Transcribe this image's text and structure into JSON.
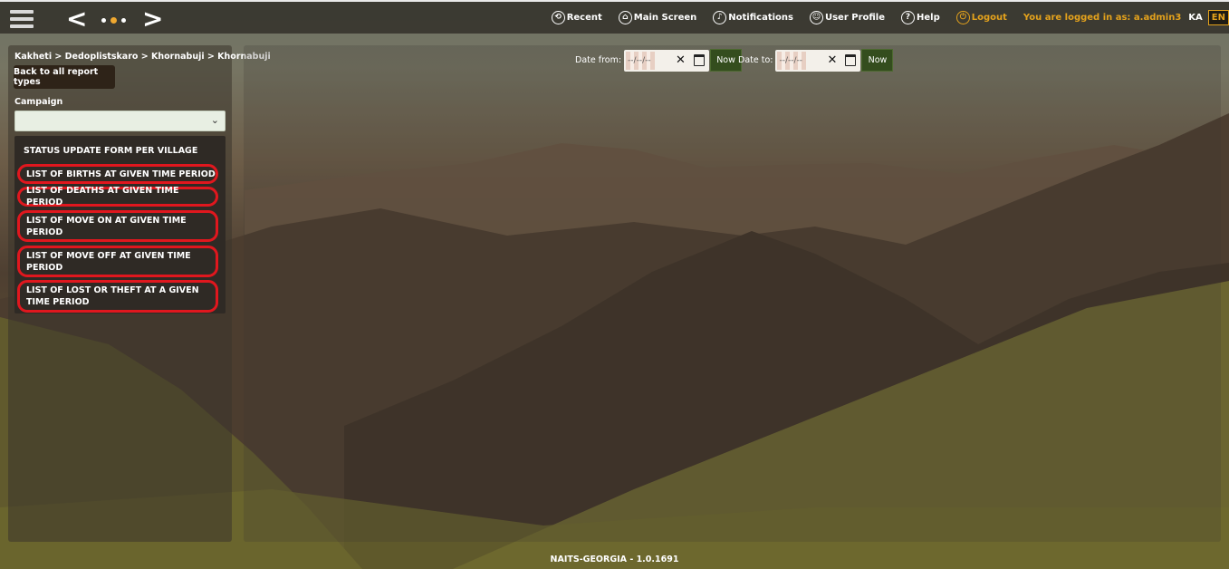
{
  "topbar": {
    "nav_prev": "<",
    "nav_next": ">",
    "menu": [
      {
        "label": "Recent",
        "icon": "recent-icon",
        "glyph": "⟲"
      },
      {
        "label": "Main Screen",
        "icon": "home-icon",
        "glyph": "⌂"
      },
      {
        "label": "Notifications",
        "icon": "bell-icon",
        "glyph": "♪"
      },
      {
        "label": "User Profile",
        "icon": "user-icon",
        "glyph": "☺"
      },
      {
        "label": "Help",
        "icon": "help-icon",
        "glyph": "?"
      }
    ],
    "logout_label": "Logout",
    "logout_glyph": "⏻",
    "logged_in_text": "You are logged in as: a.admin3",
    "lang_ka": "KA",
    "lang_en": "EN"
  },
  "sidebar": {
    "breadcrumb": "Kakheti > Dedoplistskaro > Khornabuji > Khornabuji",
    "back_button": "Back to all report types",
    "campaign_label": "Campaign",
    "campaign_value": "",
    "reports": [
      {
        "label": "STATUS UPDATE FORM PER VILLAGE",
        "highlighted": false
      },
      {
        "label": "LIST OF BIRTHS AT GIVEN TIME PERIOD",
        "highlighted": true
      },
      {
        "label": "LIST OF DEATHS AT GIVEN TIME PERIOD",
        "highlighted": true
      },
      {
        "label": "LIST OF MOVE ON AT GIVEN TIME PERIOD",
        "highlighted": true
      },
      {
        "label": "LIST OF MOVE OFF AT GIVEN TIME PERIOD",
        "highlighted": true
      },
      {
        "label": "LIST OF LOST OR THEFT AT A GIVEN TIME PERIOD",
        "highlighted": true
      }
    ]
  },
  "filters": {
    "date_from_label": "Date from:",
    "date_to_label": "Date to:",
    "date_placeholder": "--/--/--",
    "clear_glyph": "✕",
    "now_label": "Now"
  },
  "footer": {
    "version": "NAITS-GEORGIA - 1.0.1691"
  },
  "colors": {
    "accent": "#e4a21c",
    "highlight": "#e0171e",
    "now_button": "#344d1e"
  }
}
